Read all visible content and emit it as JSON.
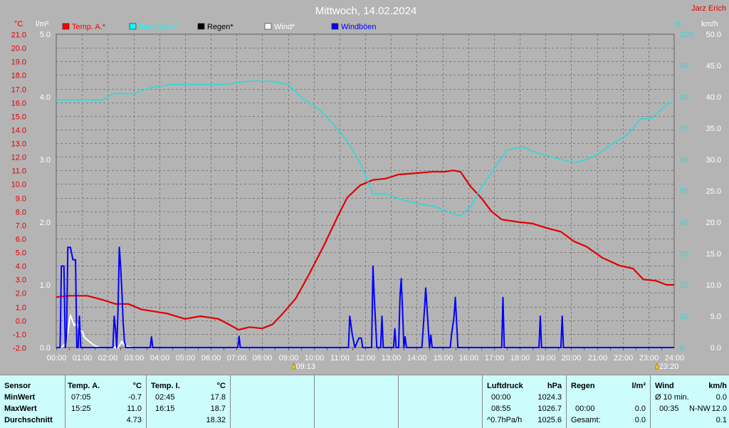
{
  "chart_data": {
    "type": "line",
    "title": "Mittwoch, 14.02.2024",
    "station": "Jarz Erich",
    "left_axis_temp": {
      "unit": "°C",
      "min": -2,
      "max": 21,
      "step": 1
    },
    "left_axis_rain": {
      "unit": "l/m²",
      "min": 0,
      "max": 5,
      "step": 1
    },
    "right_axis_hum": {
      "unit": "%",
      "min": 0,
      "max": 100,
      "step": 10
    },
    "right_axis_wind": {
      "unit": "km/h",
      "min": 0,
      "max": 50,
      "step": 5
    },
    "x_range": [
      0,
      24
    ],
    "x_ticks": [
      "00:00",
      "01:00",
      "02:00",
      "03:00",
      "04:00",
      "05:00",
      "06:00",
      "07:00",
      "08:00",
      "09:00",
      "10:00",
      "11:00",
      "12:00",
      "13:00",
      "14:00",
      "15:00",
      "16:00",
      "17:00",
      "18:00",
      "19:00",
      "20:00",
      "21:00",
      "22:00",
      "23:00",
      "24:00"
    ],
    "sun_markers": [
      {
        "x": 9.22,
        "label": "09:13"
      },
      {
        "x": 23.33,
        "label": "23:20"
      }
    ],
    "legend": [
      {
        "name": "Temp. A.*",
        "color": "#ff0000"
      },
      {
        "name": "Feuchte A.*",
        "color": "#00ffff"
      },
      {
        "name": "Regen*",
        "color": "#000000"
      },
      {
        "name": "Wind*",
        "color": "#ffffff"
      },
      {
        "name": "Windböen",
        "color": "#0000ff"
      }
    ],
    "series": [
      {
        "name": "Temp. A.*",
        "axis": "temp",
        "color": "#e00000",
        "points": [
          [
            0,
            1.7
          ],
          [
            0.5,
            1.8
          ],
          [
            1.2,
            1.8
          ],
          [
            1.8,
            1.5
          ],
          [
            2.3,
            1.2
          ],
          [
            2.8,
            1.2
          ],
          [
            3.3,
            0.8
          ],
          [
            4.3,
            0.5
          ],
          [
            5.0,
            0.1
          ],
          [
            5.6,
            0.3
          ],
          [
            6.3,
            0.1
          ],
          [
            6.8,
            -0.4
          ],
          [
            7.08,
            -0.7
          ],
          [
            7.5,
            -0.5
          ],
          [
            8.0,
            -0.6
          ],
          [
            8.4,
            -0.3
          ],
          [
            8.8,
            0.5
          ],
          [
            9.3,
            1.6
          ],
          [
            9.8,
            3.3
          ],
          [
            10.4,
            5.5
          ],
          [
            10.9,
            7.5
          ],
          [
            11.3,
            9.0
          ],
          [
            11.8,
            9.9
          ],
          [
            12.3,
            10.3
          ],
          [
            12.8,
            10.4
          ],
          [
            13.3,
            10.7
          ],
          [
            14.0,
            10.8
          ],
          [
            14.6,
            10.9
          ],
          [
            15.1,
            10.9
          ],
          [
            15.4,
            11.0
          ],
          [
            15.7,
            10.9
          ],
          [
            16.1,
            9.8
          ],
          [
            16.5,
            9.0
          ],
          [
            16.9,
            8.0
          ],
          [
            17.3,
            7.4
          ],
          [
            18.0,
            7.2
          ],
          [
            18.5,
            7.1
          ],
          [
            19.0,
            6.8
          ],
          [
            19.6,
            6.5
          ],
          [
            20.1,
            5.8
          ],
          [
            20.6,
            5.4
          ],
          [
            21.2,
            4.6
          ],
          [
            21.9,
            4.0
          ],
          [
            22.4,
            3.8
          ],
          [
            22.8,
            3.0
          ],
          [
            23.3,
            2.9
          ],
          [
            23.7,
            2.6
          ],
          [
            24,
            2.6
          ]
        ]
      },
      {
        "name": "Feuchte A.*",
        "axis": "hum",
        "color": "#30d8d8",
        "points": [
          [
            0,
            79
          ],
          [
            1.8,
            79
          ],
          [
            2.2,
            81
          ],
          [
            3.0,
            81
          ],
          [
            3.7,
            83
          ],
          [
            4.5,
            84
          ],
          [
            5.5,
            84
          ],
          [
            6.5,
            84
          ],
          [
            7.5,
            85
          ],
          [
            8.3,
            85
          ],
          [
            9.0,
            84
          ],
          [
            9.5,
            80
          ],
          [
            10.2,
            76
          ],
          [
            10.8,
            71
          ],
          [
            11.3,
            66
          ],
          [
            11.8,
            59
          ],
          [
            12.3,
            49
          ],
          [
            12.8,
            49
          ],
          [
            13.5,
            47
          ],
          [
            14.0,
            46
          ],
          [
            14.7,
            45
          ],
          [
            15.3,
            43
          ],
          [
            15.7,
            42
          ],
          [
            16.1,
            45
          ],
          [
            16.5,
            51
          ],
          [
            17.0,
            57
          ],
          [
            17.5,
            63
          ],
          [
            18.1,
            64
          ],
          [
            18.7,
            62
          ],
          [
            19.2,
            61
          ],
          [
            19.6,
            60
          ],
          [
            20.2,
            59
          ],
          [
            20.6,
            60
          ],
          [
            21.1,
            62
          ],
          [
            21.6,
            65
          ],
          [
            22.2,
            68
          ],
          [
            22.7,
            73
          ],
          [
            23.1,
            73
          ],
          [
            23.5,
            76
          ],
          [
            23.8,
            78
          ],
          [
            24,
            78
          ]
        ]
      },
      {
        "name": "Wind*",
        "axis": "wind",
        "color": "#ffffff",
        "points": [
          [
            0.2,
            0
          ],
          [
            0.35,
            0.6
          ],
          [
            0.45,
            2.4
          ],
          [
            0.55,
            5.2
          ],
          [
            0.6,
            4.6
          ],
          [
            0.7,
            3.5
          ],
          [
            0.8,
            3.9
          ],
          [
            0.9,
            2.7
          ],
          [
            1.0,
            2.6
          ],
          [
            1.1,
            1.6
          ],
          [
            1.3,
            0.9
          ],
          [
            1.5,
            0.3
          ],
          [
            1.7,
            0
          ],
          [
            2.4,
            0
          ],
          [
            2.45,
            0.3
          ],
          [
            2.55,
            1.0
          ],
          [
            2.6,
            0.6
          ],
          [
            2.7,
            0.2
          ],
          [
            3.0,
            0
          ]
        ]
      },
      {
        "name": "Windböen",
        "axis": "wind",
        "color": "#0000ff",
        "points": [
          [
            0,
            0
          ],
          [
            0.15,
            0
          ],
          [
            0.2,
            13
          ],
          [
            0.3,
            13
          ],
          [
            0.35,
            0
          ],
          [
            0.4,
            2
          ],
          [
            0.45,
            16
          ],
          [
            0.55,
            16
          ],
          [
            0.6,
            15
          ],
          [
            0.65,
            14
          ],
          [
            0.7,
            14
          ],
          [
            0.75,
            14
          ],
          [
            0.8,
            0
          ],
          [
            0.85,
            0
          ],
          [
            0.9,
            5
          ],
          [
            0.95,
            0
          ],
          [
            2.2,
            0
          ],
          [
            2.25,
            5
          ],
          [
            2.3,
            3
          ],
          [
            2.35,
            0
          ],
          [
            2.4,
            6
          ],
          [
            2.45,
            16
          ],
          [
            2.5,
            13
          ],
          [
            2.55,
            9
          ],
          [
            2.6,
            4
          ],
          [
            2.65,
            1
          ],
          [
            2.7,
            0
          ],
          [
            3.65,
            0
          ],
          [
            3.7,
            1.7
          ],
          [
            3.75,
            0
          ],
          [
            7.05,
            0
          ],
          [
            7.1,
            1.8
          ],
          [
            7.15,
            0
          ],
          [
            11.35,
            0
          ],
          [
            11.4,
            5
          ],
          [
            11.5,
            2
          ],
          [
            11.6,
            0
          ],
          [
            11.75,
            1.5
          ],
          [
            11.85,
            1.5
          ],
          [
            11.9,
            0
          ],
          [
            12.25,
            0
          ],
          [
            12.3,
            13
          ],
          [
            12.35,
            8
          ],
          [
            12.45,
            0
          ],
          [
            12.6,
            0
          ],
          [
            12.65,
            5
          ],
          [
            12.7,
            0
          ],
          [
            13.1,
            0
          ],
          [
            13.15,
            3
          ],
          [
            13.2,
            0
          ],
          [
            13.3,
            0
          ],
          [
            13.35,
            8
          ],
          [
            13.4,
            11
          ],
          [
            13.45,
            6
          ],
          [
            13.5,
            0
          ],
          [
            13.55,
            1.7
          ],
          [
            13.6,
            0
          ],
          [
            14.2,
            0
          ],
          [
            14.3,
            6
          ],
          [
            14.35,
            9.5
          ],
          [
            14.45,
            3
          ],
          [
            14.5,
            0
          ],
          [
            14.55,
            2
          ],
          [
            14.6,
            0
          ],
          [
            15.3,
            0
          ],
          [
            15.35,
            2
          ],
          [
            15.45,
            5
          ],
          [
            15.5,
            8
          ],
          [
            15.55,
            4
          ],
          [
            15.6,
            0
          ],
          [
            17.3,
            0
          ],
          [
            17.35,
            8
          ],
          [
            17.4,
            0
          ],
          [
            18.75,
            0
          ],
          [
            18.8,
            5
          ],
          [
            18.85,
            0
          ],
          [
            19.6,
            0
          ],
          [
            19.65,
            5
          ],
          [
            19.7,
            0
          ],
          [
            24,
            0
          ]
        ]
      }
    ]
  },
  "panel": {
    "sensor": {
      "header": "Sensor",
      "rows": [
        "MinWert",
        "MaxWert",
        "Durchschnitt"
      ]
    },
    "temp_a": {
      "header": "Temp. A.",
      "unit": "°C",
      "times": [
        "07:05",
        "15:25",
        ""
      ],
      "values": [
        "-0.7",
        "11.0",
        "4.73"
      ]
    },
    "temp_i": {
      "header": "Temp. I.",
      "unit": "°C",
      "times": [
        "02:45",
        "16:15",
        ""
      ],
      "values": [
        "17.8",
        "18.7",
        "18.32"
      ]
    },
    "pressure": {
      "header": "Luftdruck",
      "unit": "hPa",
      "labels": [
        "00:00",
        "08:55",
        "^0.7hPa/h"
      ],
      "values": [
        "1024.3",
        "1026.7",
        "1025.6"
      ]
    },
    "rain": {
      "header": "Regen",
      "unit": "l/m²",
      "labels": [
        "",
        "00:00",
        "Gesamt:"
      ],
      "values": [
        "",
        "0.0",
        "0.0"
      ]
    },
    "wind": {
      "header": "Wind",
      "unit": "km/h",
      "labels": [
        "Ø 10 min.",
        "00:35",
        ""
      ],
      "dirs": [
        "",
        "N-NW",
        ""
      ],
      "values": [
        "0.0",
        "12.0",
        "0.1"
      ]
    }
  }
}
